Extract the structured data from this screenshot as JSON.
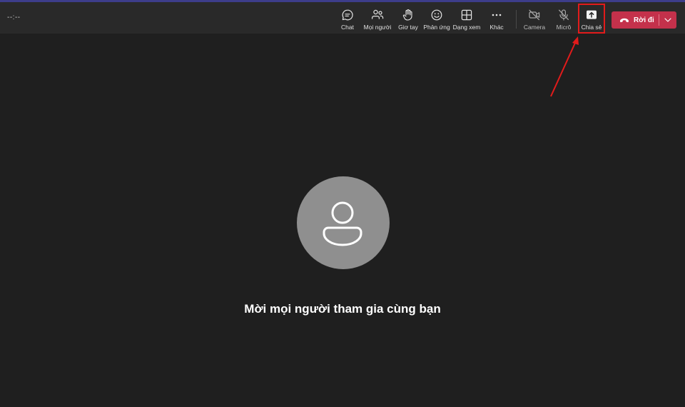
{
  "meeting": {
    "timer": "--:--"
  },
  "toolbar": {
    "items": [
      {
        "id": "chat",
        "label": "Chat",
        "icon": "chat-icon"
      },
      {
        "id": "people",
        "label": "Mọi người",
        "icon": "people-icon"
      },
      {
        "id": "raise-hand",
        "label": "Giơ tay",
        "icon": "raise-hand-icon"
      },
      {
        "id": "reactions",
        "label": "Phản ứng",
        "icon": "smiley-icon"
      },
      {
        "id": "view",
        "label": "Dạng xem",
        "icon": "grid-icon"
      },
      {
        "id": "more",
        "label": "Khác",
        "icon": "more-icon"
      },
      {
        "id": "camera",
        "label": "Camera",
        "icon": "camera-off-icon"
      },
      {
        "id": "mic",
        "label": "Micrô",
        "icon": "mic-off-icon"
      },
      {
        "id": "share",
        "label": "Chia sẻ",
        "icon": "share-screen-icon"
      }
    ],
    "leave_label": "Rời đi"
  },
  "stage": {
    "invite_text": "Mời mọi người tham gia cùng bạn"
  },
  "colors": {
    "background": "#1f1f1f",
    "toolbar": "#292929",
    "leave_button": "#c4314b",
    "highlight": "#e21b1b",
    "avatar": "#8f8f8f"
  }
}
